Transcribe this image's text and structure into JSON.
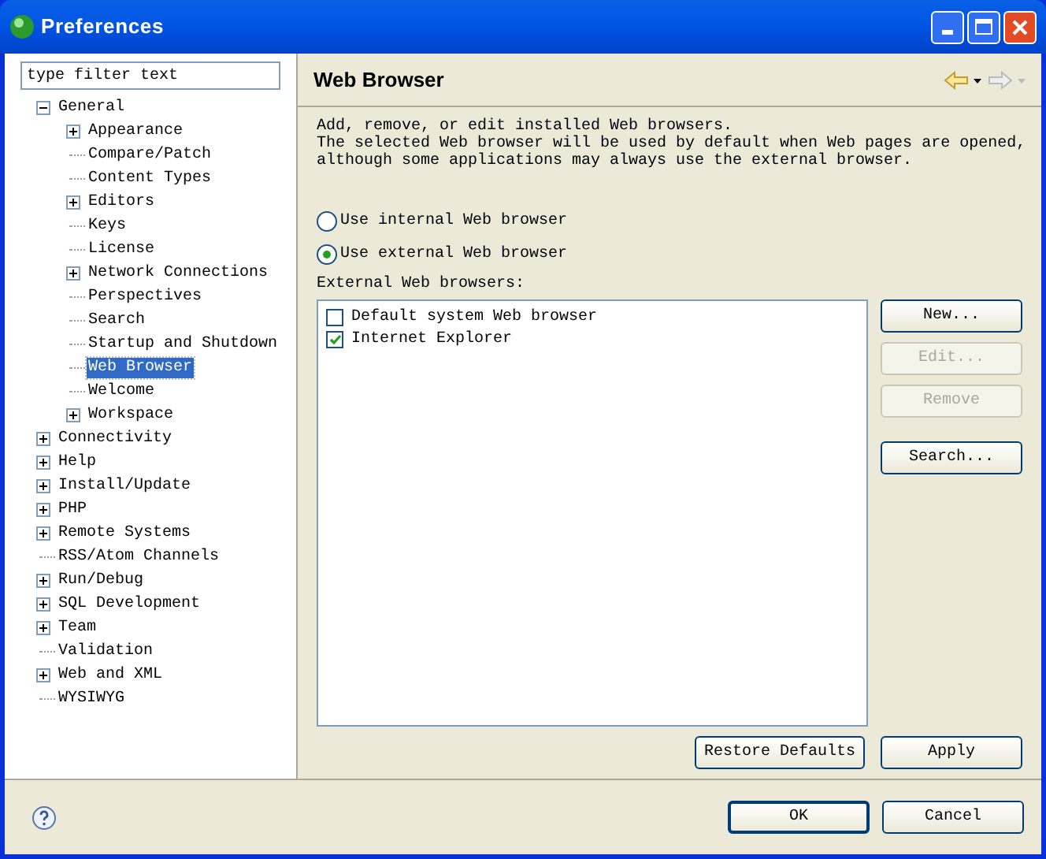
{
  "window": {
    "title": "Preferences"
  },
  "filter": {
    "placeholder": "type filter text"
  },
  "tree": [
    {
      "label": "General",
      "kind": "folder",
      "expanded": true,
      "selected": false,
      "children": [
        {
          "label": "Appearance",
          "kind": "folder",
          "expanded": false,
          "selected": false
        },
        {
          "label": "Compare/Patch",
          "kind": "leaf",
          "selected": false
        },
        {
          "label": "Content Types",
          "kind": "leaf",
          "selected": false
        },
        {
          "label": "Editors",
          "kind": "folder",
          "expanded": false,
          "selected": false
        },
        {
          "label": "Keys",
          "kind": "leaf",
          "selected": false
        },
        {
          "label": "License",
          "kind": "leaf",
          "selected": false
        },
        {
          "label": "Network Connections",
          "kind": "folder",
          "expanded": false,
          "selected": false
        },
        {
          "label": "Perspectives",
          "kind": "leaf",
          "selected": false
        },
        {
          "label": "Search",
          "kind": "leaf",
          "selected": false
        },
        {
          "label": "Startup and Shutdown",
          "kind": "leaf",
          "selected": false
        },
        {
          "label": "Web Browser",
          "kind": "leaf",
          "selected": true
        },
        {
          "label": "Welcome",
          "kind": "leaf",
          "selected": false
        },
        {
          "label": "Workspace",
          "kind": "folder",
          "expanded": false,
          "selected": false
        }
      ]
    },
    {
      "label": "Connectivity",
      "kind": "folder",
      "expanded": false,
      "selected": false
    },
    {
      "label": "Help",
      "kind": "folder",
      "expanded": false,
      "selected": false
    },
    {
      "label": "Install/Update",
      "kind": "folder",
      "expanded": false,
      "selected": false
    },
    {
      "label": "PHP",
      "kind": "folder",
      "expanded": false,
      "selected": false
    },
    {
      "label": "Remote Systems",
      "kind": "folder",
      "expanded": false,
      "selected": false
    },
    {
      "label": "RSS/Atom Channels",
      "kind": "leaf",
      "selected": false
    },
    {
      "label": "Run/Debug",
      "kind": "folder",
      "expanded": false,
      "selected": false
    },
    {
      "label": "SQL Development",
      "kind": "folder",
      "expanded": false,
      "selected": false
    },
    {
      "label": "Team",
      "kind": "folder",
      "expanded": false,
      "selected": false
    },
    {
      "label": "Validation",
      "kind": "leaf",
      "selected": false
    },
    {
      "label": "Web and XML",
      "kind": "folder",
      "expanded": false,
      "selected": false
    },
    {
      "label": "WYSIWYG",
      "kind": "leaf",
      "selected": false
    }
  ],
  "page": {
    "title": "Web Browser",
    "description": [
      "Add, remove, or edit installed Web browsers.",
      "The selected Web browser will be used by default when Web pages are opened,",
      "although some applications may always use the external browser."
    ],
    "radios": [
      {
        "label": "Use internal Web browser",
        "selected": false
      },
      {
        "label": "Use external Web browser",
        "selected": true
      }
    ],
    "list_label": "External Web browsers:",
    "browsers": [
      {
        "label": "Default system Web browser",
        "checked": false
      },
      {
        "label": "Internet Explorer",
        "checked": true
      }
    ],
    "side_buttons": [
      {
        "label": "New...",
        "disabled": false
      },
      {
        "label": "Edit...",
        "disabled": true
      },
      {
        "label": "Remove",
        "disabled": true
      },
      {
        "label": "Search...",
        "disabled": false
      }
    ],
    "page_buttons": [
      "Restore Defaults",
      "Apply"
    ]
  },
  "footer_buttons": [
    "OK",
    "Cancel"
  ]
}
